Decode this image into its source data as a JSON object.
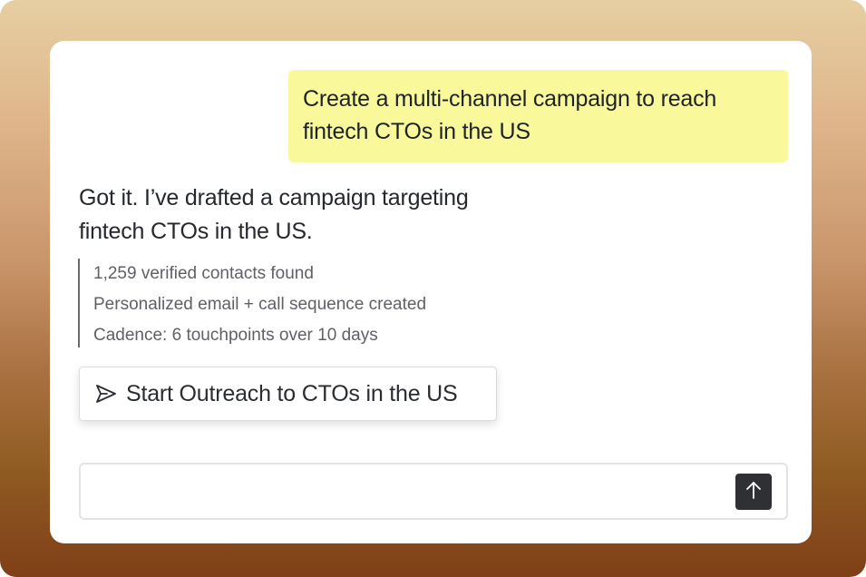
{
  "conversation": {
    "user_message_line1": "Create a multi-channel campaign to reach",
    "user_message_line2": "fintech CTOs in the US",
    "assistant_line1": "Got it. I’ve drafted a campaign targeting",
    "assistant_line2": "fintech CTOs in the US.",
    "details": [
      "1,259 verified contacts found",
      "Personalized email + call sequence created",
      "Cadence: 6 touchpoints over 10 days"
    ]
  },
  "action": {
    "icon": "send-icon",
    "label": "Start Outreach to CTOs in the US"
  },
  "composer": {
    "value": "",
    "placeholder": "",
    "send_icon": "arrow-up-icon"
  },
  "colors": {
    "user_bubble": "#f9f99b",
    "send_button": "#2e3033",
    "detail_border": "#6b6b6b"
  }
}
